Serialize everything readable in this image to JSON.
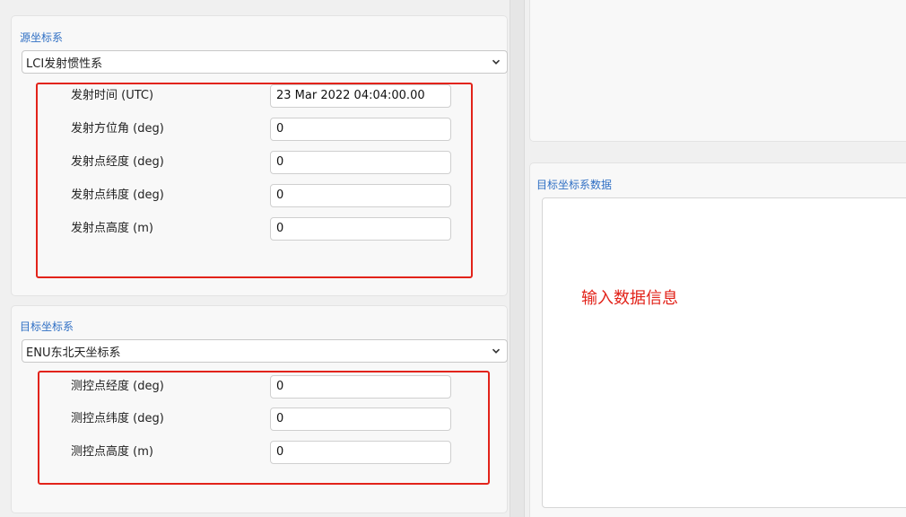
{
  "source_frame": {
    "title": "源坐标系",
    "selected": "LCI发射惯性系",
    "fields": [
      {
        "label": "发射时间 (UTC)",
        "value": "23 Mar 2022 04:04:00.00"
      },
      {
        "label": "发射方位角 (deg)",
        "value": "0"
      },
      {
        "label": "发射点经度 (deg)",
        "value": "0"
      },
      {
        "label": "发射点纬度 (deg)",
        "value": "0"
      },
      {
        "label": "发射点高度 (m)",
        "value": "0"
      }
    ]
  },
  "target_frame": {
    "title": "目标坐标系",
    "selected": "ENU东北天坐标系",
    "fields": [
      {
        "label": "测控点经度 (deg)",
        "value": "0"
      },
      {
        "label": "测控点纬度 (deg)",
        "value": "0"
      },
      {
        "label": "测控点高度 (m)",
        "value": "0"
      }
    ]
  },
  "right": {
    "target_data_title": "目标坐标系数据",
    "hint_text": "输入数据信息"
  },
  "colors": {
    "accent_blue": "#2f6fc4",
    "annotation_red": "#e2231a"
  },
  "icons": {
    "dropdown": "chevron-down-icon"
  }
}
